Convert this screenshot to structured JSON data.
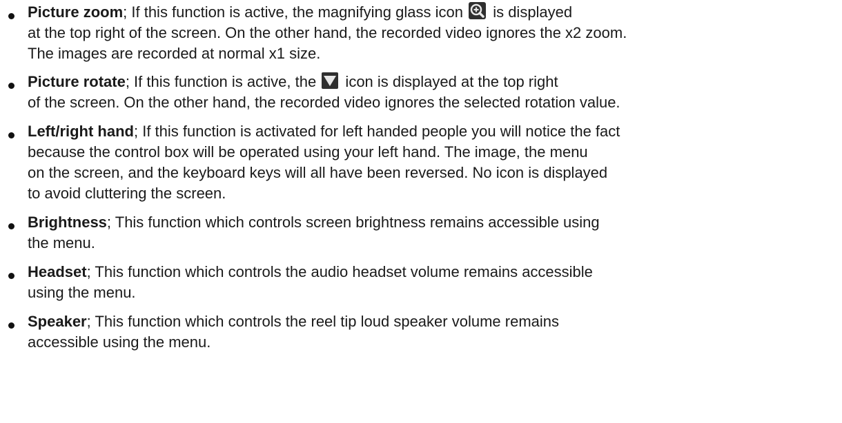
{
  "items": [
    {
      "term": "Picture zoom",
      "lines": [
        "; If this function is active, the magnifying glass icon",
        " is displayed",
        "at the top right of the screen. On the other hand, the recorded video ignores the x2 zoom.",
        "The images are recorded at normal x1 size."
      ],
      "icon": "zoom-in-icon"
    },
    {
      "term": "Picture rotate",
      "lines": [
        "; If this function is active, the",
        " icon is displayed at the top right",
        "of the screen. On the other hand, the recorded video ignores the selected rotation value."
      ],
      "icon": "rotate-triangle-icon"
    },
    {
      "term": "Left/right hand",
      "lines": [
        "; If this function is activated for left handed people you will notice the fact",
        "because the control box will be operated using your left hand. The image, the menu",
        "on the screen, and the keyboard keys will all have been reversed. No icon is displayed",
        "to avoid cluttering the screen."
      ]
    },
    {
      "term": "Brightness",
      "lines": [
        "; This function which controls screen brightness remains accessible using",
        "the menu."
      ]
    },
    {
      "term": "Headset",
      "lines": [
        "; This function which controls the audio headset volume remains accessible",
        "using the menu."
      ]
    },
    {
      "term": "Speaker",
      "lines": [
        "; This function which controls the reel tip loud speaker volume remains",
        "accessible using the menu."
      ]
    }
  ],
  "colors": {
    "text": "#1a1a1a",
    "icon_dark": "#2f2f2f",
    "icon_light": "#e8e8e8"
  }
}
